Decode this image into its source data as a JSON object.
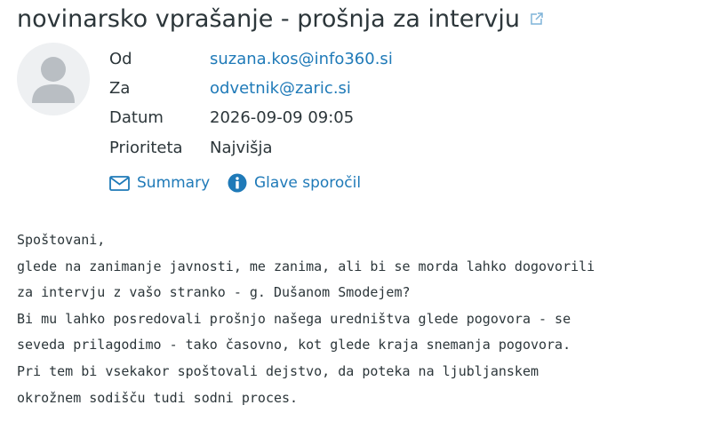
{
  "message": {
    "subject": "novinarsko vprašanje - prošnja za intervju",
    "open_external_icon": "external-link-icon",
    "headers": [
      {
        "label": "Od",
        "value": "suzana.kos@info360.si"
      },
      {
        "label": "Za",
        "value": "odvetnik@zaric.si"
      },
      {
        "label": "Datum",
        "value": "2026-09-09 09:05"
      },
      {
        "label": "Prioriteta",
        "value": "Najvišja"
      }
    ],
    "actions": {
      "summary": "Summary",
      "headers": "Glave sporočil"
    },
    "body_lines": [
      "Spoštovani,",
      "glede na zanimanje javnosti, me zanima, ali bi se morda lahko dogovorili",
      "za intervju z vašo stranko - g. Dušanom Smodejem?",
      "Bi mu lahko posredovali prošnjo našega uredništva glede pogovora - se",
      "seveda prilagodimo - tako časovno, kot glede kraja snemanja pogovora.",
      "Pri tem bi vsekakor spoštovali dejstvo, da poteka na ljubljanskem",
      "okrožnem sodišču tudi sodni proces."
    ]
  },
  "colors": {
    "link": "#1f7ab8",
    "text": "#2c363a",
    "avatar_bg": "#eef0f2",
    "avatar_fg": "#b9bec3"
  }
}
